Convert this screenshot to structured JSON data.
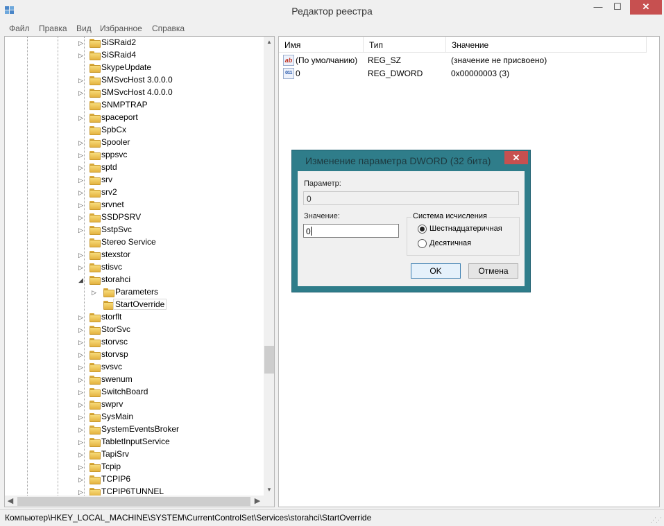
{
  "window": {
    "title": "Редактор реестра"
  },
  "window_controls": {
    "minimize": "—",
    "maximize": "☐",
    "close": "✕"
  },
  "menu": [
    "Файл",
    "Правка",
    "Вид",
    "Избранное",
    "Справка"
  ],
  "tree": {
    "items": [
      {
        "label": "SiSRaid2",
        "expander": "▷"
      },
      {
        "label": "SiSRaid4",
        "expander": "▷"
      },
      {
        "label": "SkypeUpdate",
        "expander": ""
      },
      {
        "label": "SMSvcHost 3.0.0.0",
        "expander": "▷"
      },
      {
        "label": "SMSvcHost 4.0.0.0",
        "expander": "▷"
      },
      {
        "label": "SNMPTRAP",
        "expander": ""
      },
      {
        "label": "spaceport",
        "expander": "▷"
      },
      {
        "label": "SpbCx",
        "expander": ""
      },
      {
        "label": "Spooler",
        "expander": "▷"
      },
      {
        "label": "sppsvc",
        "expander": "▷"
      },
      {
        "label": "sptd",
        "expander": "▷"
      },
      {
        "label": "srv",
        "expander": "▷"
      },
      {
        "label": "srv2",
        "expander": "▷"
      },
      {
        "label": "srvnet",
        "expander": "▷"
      },
      {
        "label": "SSDPSRV",
        "expander": "▷"
      },
      {
        "label": "SstpSvc",
        "expander": "▷"
      },
      {
        "label": "Stereo Service",
        "expander": ""
      },
      {
        "label": "stexstor",
        "expander": "▷"
      },
      {
        "label": "stisvc",
        "expander": "▷"
      },
      {
        "label": "storahci",
        "expander": "◢"
      },
      {
        "label": "Parameters",
        "expander": "▷",
        "child": true
      },
      {
        "label": "StartOverride",
        "expander": "",
        "child": true,
        "selected": true
      },
      {
        "label": "storflt",
        "expander": "▷"
      },
      {
        "label": "StorSvc",
        "expander": "▷"
      },
      {
        "label": "storvsc",
        "expander": "▷"
      },
      {
        "label": "storvsp",
        "expander": "▷"
      },
      {
        "label": "svsvc",
        "expander": "▷"
      },
      {
        "label": "swenum",
        "expander": "▷"
      },
      {
        "label": "SwitchBoard",
        "expander": "▷"
      },
      {
        "label": "swprv",
        "expander": "▷"
      },
      {
        "label": "SysMain",
        "expander": "▷"
      },
      {
        "label": "SystemEventsBroker",
        "expander": "▷"
      },
      {
        "label": "TabletInputService",
        "expander": "▷"
      },
      {
        "label": "TapiSrv",
        "expander": "▷"
      },
      {
        "label": "Tcpip",
        "expander": "▷"
      },
      {
        "label": "TCPIP6",
        "expander": "▷"
      },
      {
        "label": "TCPIP6TUNNEL",
        "expander": "▷"
      }
    ]
  },
  "scroll_arrows": {
    "up": "▲",
    "down": "▼",
    "left": "◀",
    "right": "▶"
  },
  "list": {
    "columns": [
      "Имя",
      "Тип",
      "Значение"
    ],
    "rows": [
      {
        "icon": "string-value-icon",
        "icon_text": "ab",
        "name": "(По умолчанию)",
        "type": "REG_SZ",
        "value": "(значение не присвоено)"
      },
      {
        "icon": "dword-value-icon",
        "icon_text": "011",
        "name": "0",
        "type": "REG_DWORD",
        "value": "0x00000003 (3)"
      }
    ]
  },
  "status": {
    "path": "Компьютер\\HKEY_LOCAL_MACHINE\\SYSTEM\\CurrentControlSet\\Services\\storahci\\StartOverride"
  },
  "dialog": {
    "title": "Изменение параметра DWORD (32 бита)",
    "close": "✕",
    "param_label": "Параметр:",
    "param_value": "0",
    "value_label": "Значение:",
    "value": "0",
    "base_group": "Система исчисления",
    "base_options": [
      {
        "label": "Шестнадцатеричная",
        "checked": true
      },
      {
        "label": "Десятичная",
        "checked": false
      }
    ],
    "ok": "OK",
    "cancel": "Отмена"
  },
  "colors": {
    "dialog_frame": "#2f7d8a",
    "close_red": "#c75050",
    "folder": "#f0c858"
  }
}
